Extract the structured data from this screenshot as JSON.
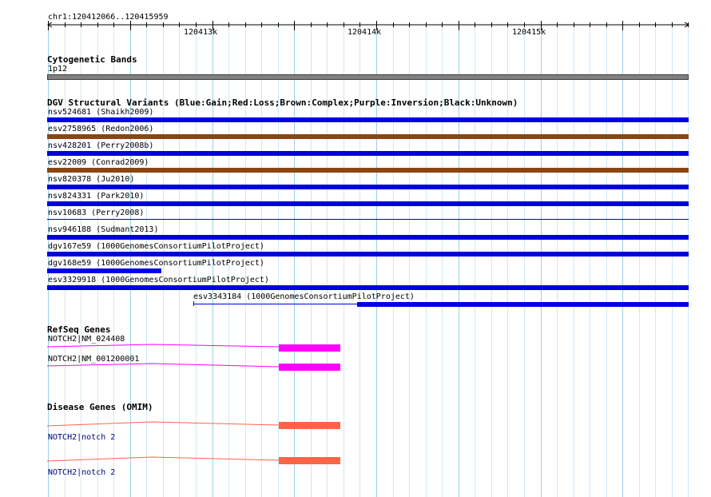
{
  "coordinates": {
    "range_label": "chr1:120412066..120415959",
    "start": 120412066,
    "end": 120415959
  },
  "ruler": {
    "ticks": [
      "120413k",
      "120414k",
      "120415k"
    ]
  },
  "tracks": {
    "cytoband": {
      "title": "Cytogenetic Bands",
      "band_label": "1p12",
      "band_color": "#808080"
    },
    "dgv": {
      "title": "DGV Structural Variants (Blue:Gain;Red:Loss;Brown:Complex;Purple:Inversion;Black:Unknown)",
      "colors": {
        "gain": "#0000e0",
        "complex": "#8b4513"
      },
      "variants": [
        {
          "label": "nsv524681 (Shaikh2009)",
          "type": "gain"
        },
        {
          "label": "esv2758965 (Redon2006)",
          "type": "complex"
        },
        {
          "label": "nsv428201 (Perry2008b)",
          "type": "gain"
        },
        {
          "label": "esv22009 (Conrad2009)",
          "type": "complex"
        },
        {
          "label": "nsv820378 (Ju2010)",
          "type": "gain"
        },
        {
          "label": "nsv824331 (Park2010)",
          "type": "gain"
        },
        {
          "label": "nsv10683 (Perry2008)",
          "type": "gain"
        },
        {
          "label": "nsv946188 (Sudmant2013)",
          "type": "gain"
        },
        {
          "label": "dgv167e59 (1000GenomesConsortiumPilotProject)",
          "type": "gain"
        },
        {
          "label": "dgv168e59 (1000GenomesConsortiumPilotProject)",
          "type": "gain"
        },
        {
          "label": "esv3329918 (1000GenomesConsortiumPilotProject)",
          "type": "gain"
        },
        {
          "label": "esv3343184 (1000GenomesConsortiumPilotProject)",
          "type": "gain"
        }
      ]
    },
    "refseq": {
      "title": "RefSeq Genes",
      "color": "#ff00ff",
      "genes": [
        {
          "label": "NOTCH2|NM_024408"
        },
        {
          "label": "NOTCH2|NM_001200001"
        }
      ]
    },
    "omim": {
      "title": "Disease Genes (OMIM)",
      "color": "#ff6347",
      "genes": [
        {
          "label": "NOTCH2|notch 2"
        },
        {
          "label": "NOTCH2|notch 2"
        }
      ]
    }
  }
}
